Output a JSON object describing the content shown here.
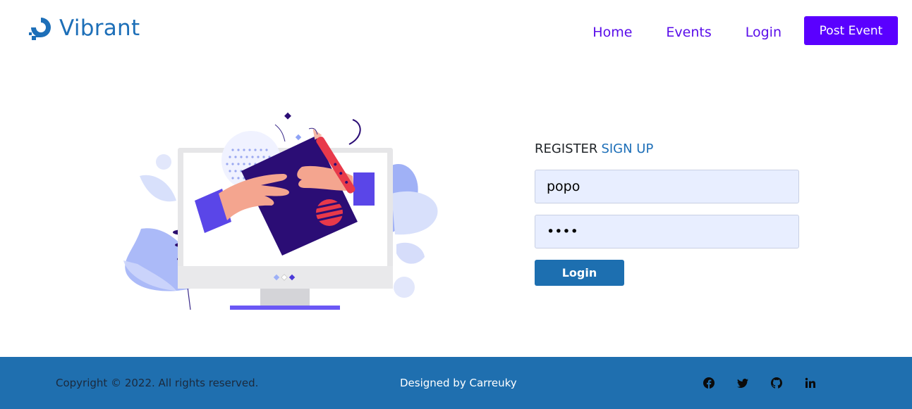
{
  "brand": {
    "name": "Vibrant",
    "icon": "vibrant-logo-icon",
    "color": "#1d6fb8"
  },
  "nav": {
    "items": [
      {
        "label": "Home"
      },
      {
        "label": "Events"
      },
      {
        "label": "Login"
      }
    ],
    "post_button": "Post Event",
    "link_color": "#5a0eea",
    "button_color": "#5a00ff"
  },
  "illustration": {
    "icon": "designer-computer-illustration"
  },
  "form": {
    "title_prefix": "REGISTER",
    "title_link": "SIGN UP",
    "username_value": "popo",
    "password_value": "popo",
    "login_button": "Login",
    "input_bg": "#e8eeff",
    "button_color": "#1d6fb0"
  },
  "footer": {
    "copyright": "Copyright © 2022. All rights reserved.",
    "designed_by": "Designed by Carreuky",
    "background": "#1f6faf",
    "social": [
      "facebook-icon",
      "twitter-icon",
      "github-icon",
      "linkedin-icon"
    ]
  }
}
